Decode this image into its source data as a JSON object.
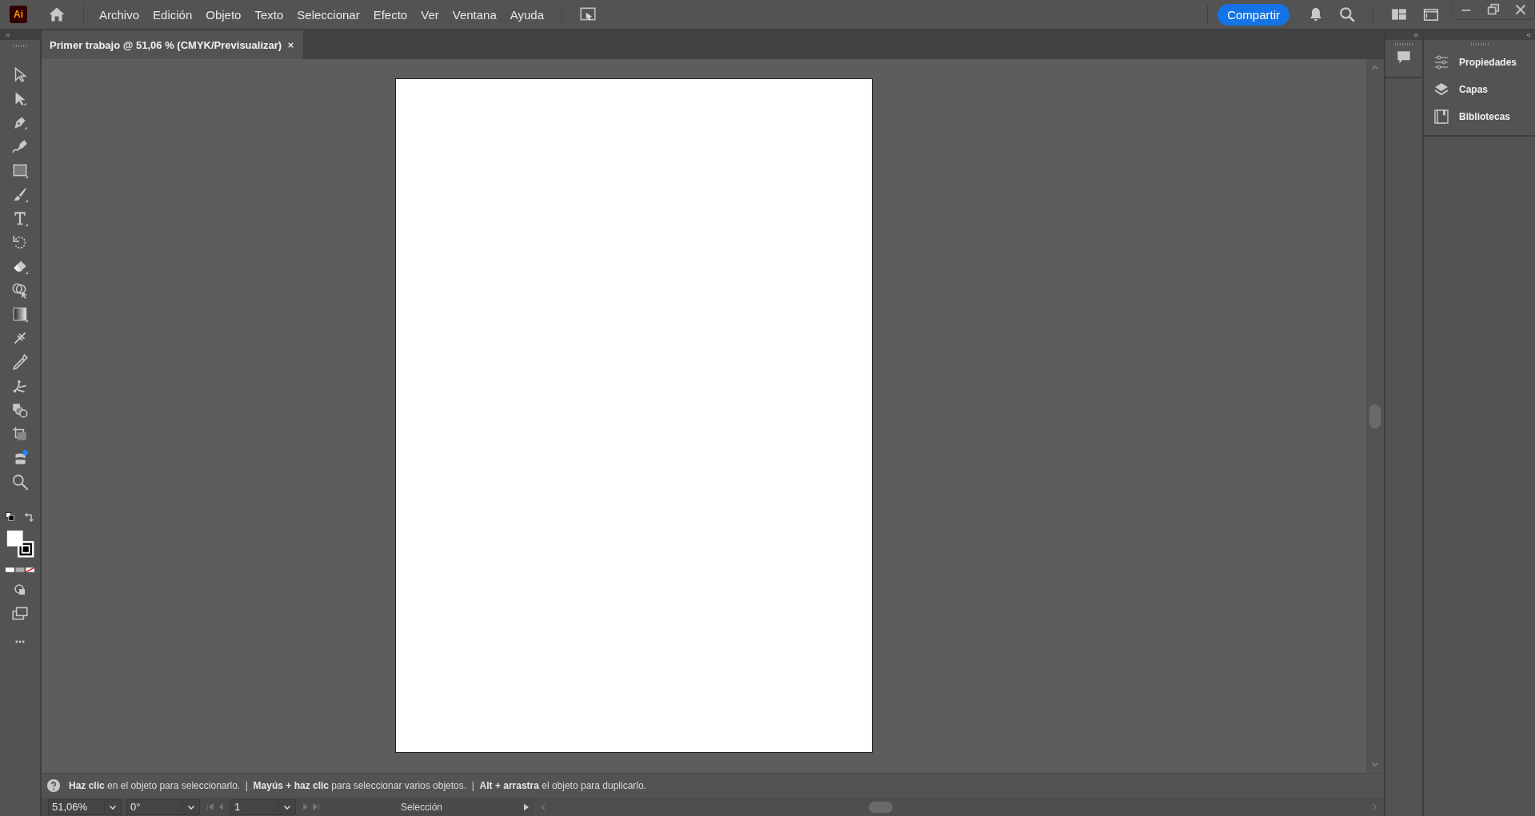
{
  "app_logo": "Ai",
  "menu": [
    "Archivo",
    "Edición",
    "Objeto",
    "Texto",
    "Seleccionar",
    "Efecto",
    "Ver",
    "Ventana",
    "Ayuda"
  ],
  "share_button": "Compartir",
  "document_tab": {
    "title": "Primer trabajo @ 51,06 % (CMYK/Previsualizar)"
  },
  "panels": [
    {
      "label": "Propiedades",
      "kind": "properties"
    },
    {
      "label": "Capas",
      "kind": "layers"
    },
    {
      "label": "Bibliotecas",
      "kind": "libraries"
    }
  ],
  "hint": "**Haz clic** en el objeto para seleccionarlo.  |  **Mayús + haz clic** para seleccionar varios objetos.  |  **Alt + arrastra** el objeto para duplicarlo.",
  "status_bar": {
    "zoom": "51,06%",
    "rotation": "0°",
    "artboard": "1",
    "current_tool": "Selección"
  }
}
